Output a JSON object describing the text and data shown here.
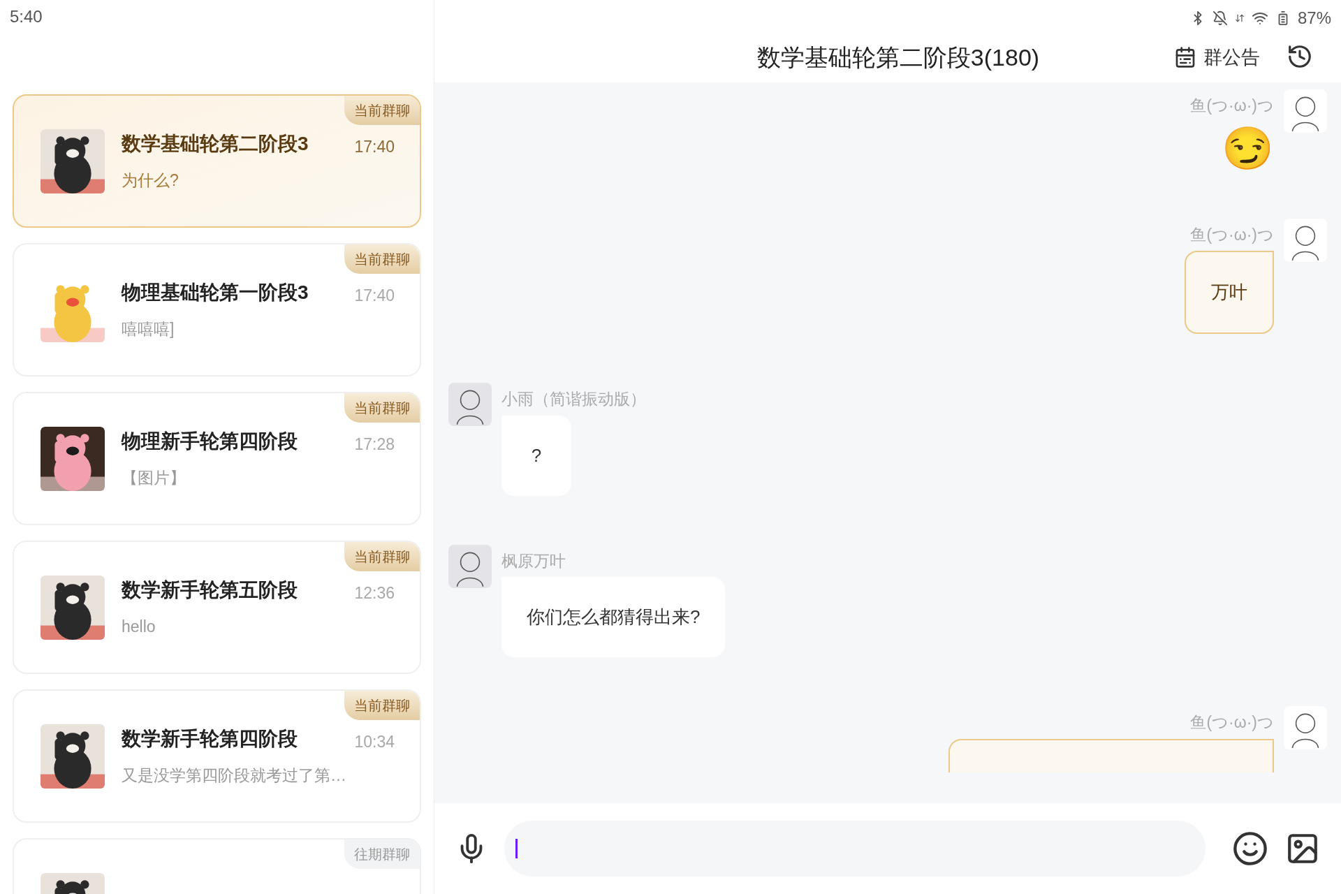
{
  "status_bar": {
    "time": "5:40",
    "battery": "87%"
  },
  "chat_list": [
    {
      "title": "数学基础轮第二阶段3",
      "preview": "为什么?",
      "time": "17:40",
      "badge": {
        "kind": "current",
        "label": "当前群聊"
      },
      "selected": true
    },
    {
      "title": "物理基础轮第一阶段3",
      "preview": "嘻嘻嘻]",
      "time": "17:40",
      "badge": {
        "kind": "current",
        "label": "当前群聊"
      },
      "selected": false
    },
    {
      "title": "物理新手轮第四阶段",
      "preview": "【图片】",
      "time": "17:28",
      "badge": {
        "kind": "current",
        "label": "当前群聊"
      },
      "selected": false
    },
    {
      "title": "数学新手轮第五阶段",
      "preview": "hello",
      "time": "12:36",
      "badge": {
        "kind": "current",
        "label": "当前群聊"
      },
      "selected": false
    },
    {
      "title": "数学新手轮第四阶段",
      "preview": "又是没学第四阶段就考过了第…",
      "time": "10:34",
      "badge": {
        "kind": "current",
        "label": "当前群聊"
      },
      "selected": false
    },
    {
      "badge": {
        "kind": "past",
        "label": "往期群聊"
      },
      "selected": false
    }
  ],
  "chat": {
    "title": "数学基础轮第二阶段3(180)",
    "notice_button": "群公告",
    "messages": [
      {
        "sender": "鱼(つ·ω·)つ",
        "outgoing": true,
        "kind": "emoji",
        "text": "😏"
      },
      {
        "sender": "鱼(つ·ω·)つ",
        "outgoing": true,
        "kind": "text",
        "text": "万叶"
      },
      {
        "sender": "小雨（简谐振动版）",
        "outgoing": false,
        "kind": "text",
        "text": "?"
      },
      {
        "sender": "枫原万叶",
        "outgoing": false,
        "kind": "text",
        "text": "你们怎么都猜得出来?"
      },
      {
        "sender": "鱼(つ·ω·)つ",
        "outgoing": true,
        "kind": "partial"
      }
    ]
  },
  "input": {
    "focused": true
  }
}
